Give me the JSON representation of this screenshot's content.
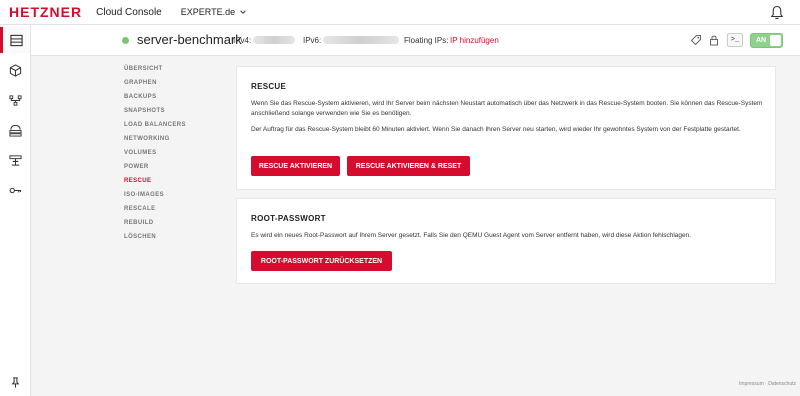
{
  "header": {
    "logo": "HETZNER",
    "app_title": "Cloud Console",
    "project": "EXPERTE.de"
  },
  "rail": {
    "icons": [
      "servers-icon",
      "volumes-box-icon",
      "networks-icon",
      "load-balancer-icon",
      "firewall-icon",
      "security-key-icon",
      "pin-icon"
    ]
  },
  "server": {
    "name": "server-benchmark",
    "ipv4_label": "IPv4:",
    "ipv6_label": "IPv6:",
    "floating_label": "Floating IPs:",
    "floating_link": "IP hinzufügen",
    "console_label": ">_",
    "power_label": "AN",
    "status_color": "#7cc576"
  },
  "subnav": {
    "items": [
      "ÜBERSICHT",
      "GRAPHEN",
      "BACKUPS",
      "SNAPSHOTS",
      "LOAD BALANCERS",
      "NETWORKING",
      "VOLUMES",
      "POWER",
      "RESCUE",
      "ISO-IMAGES",
      "RESCALE",
      "REBUILD",
      "LÖSCHEN"
    ],
    "active": "RESCUE"
  },
  "rescue": {
    "title": "RESCUE",
    "text1": "Wenn Sie das Rescue-System aktivieren, wird Ihr Server beim nächsten Neustart automatisch über das Netzwerk in das Rescue-System booten. Sie können das Rescue-System anschließend solange verwenden wie Sie es benötigen.",
    "text2": "Der Auftrag für das Rescue-System bleibt 60 Minuten aktiviert. Wenn Sie danach Ihren Server neu starten, wird wieder Ihr gewohntes System von der Festplatte gestartet.",
    "btn_activate": "RESCUE AKTIVIEREN",
    "btn_activate_reset": "RESCUE AKTIVIEREN & RESET"
  },
  "root": {
    "title": "ROOT-PASSWORT",
    "text": "Es wird ein neues Root-Passwort auf Ihrem Server gesetzt. Falls Sie den QEMU Guest Agent vom Server entfernt haben, wird diese Aktion fehlschlagen.",
    "btn_reset": "ROOT-PASSWORT ZURÜCKSETZEN"
  },
  "footer": {
    "impressum": "Impressum",
    "separator": "·",
    "datenschutz": "Datenschutz"
  },
  "colors": {
    "brand": "#d50c2d",
    "background": "#f4f4f4",
    "toggle_on": "#8fd28a"
  }
}
